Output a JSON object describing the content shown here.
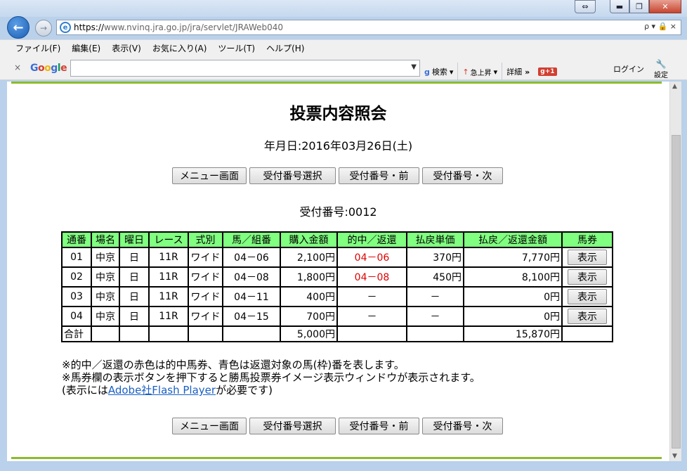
{
  "browser": {
    "window_buttons": {
      "extra": "⇔",
      "minimize": "▬",
      "maximize": "❐",
      "close": "✕"
    },
    "url_proto": "https://",
    "url_rest": "www.nvinq.jra.go.jp/jra/servlet/JRAWeb040",
    "url_tools": "ρ ▾ 🔒 ×",
    "menu": [
      "ファイル(F)",
      "編集(E)",
      "表示(V)",
      "お気に入り(A)",
      "ツール(T)",
      "ヘルプ(H)"
    ],
    "google_bar": {
      "close": "×",
      "logo": "Google",
      "search_value": "",
      "search_label": "検索",
      "rise_label": "急上昇",
      "detail_label": "詳細",
      "gplus": "g+1",
      "login": "ログイン",
      "settings": "設定"
    }
  },
  "page": {
    "title": "投票内容照会",
    "date_line": "年月日:2016年03月26日(土)",
    "buttons": [
      "メニュー画面",
      "受付番号選択",
      "受付番号・前",
      "受付番号・次"
    ],
    "receipt": "受付番号:0012",
    "table": {
      "headers": [
        "通番",
        "場名",
        "曜日",
        "レース",
        "式別",
        "馬／組番",
        "購入金額",
        "的中／返還",
        "払戻単価",
        "払戻／返還金額",
        "馬券"
      ],
      "rows": [
        {
          "no": "01",
          "venue": "中京",
          "day": "日",
          "race": "11R",
          "type": "ワイド",
          "combo": "04－06",
          "amount": "2,100円",
          "hit": "04－06",
          "unit": "370円",
          "payout": "7,770円",
          "btn": "表示"
        },
        {
          "no": "02",
          "venue": "中京",
          "day": "日",
          "race": "11R",
          "type": "ワイド",
          "combo": "04－08",
          "amount": "1,800円",
          "hit": "04－08",
          "unit": "450円",
          "payout": "8,100円",
          "btn": "表示"
        },
        {
          "no": "03",
          "venue": "中京",
          "day": "日",
          "race": "11R",
          "type": "ワイド",
          "combo": "04－11",
          "amount": "400円",
          "hit": "－",
          "unit": "－",
          "payout": "0円",
          "btn": "表示"
        },
        {
          "no": "04",
          "venue": "中京",
          "day": "日",
          "race": "11R",
          "type": "ワイド",
          "combo": "04－15",
          "amount": "700円",
          "hit": "－",
          "unit": "－",
          "payout": "0円",
          "btn": "表示"
        }
      ],
      "total_label": "合計",
      "total_amount": "5,000円",
      "total_payout": "15,870円"
    },
    "notes": {
      "line1": "※的中／返還の赤色は的中馬券、青色は返還対象の馬(枠)番を表します。",
      "line2": "※馬券欄の表示ボタンを押下すると勝馬投票券イメージ表示ウィンドウが表示されます。",
      "line3_pre": "(表示には",
      "line3_link": "Adobe社Flash Player",
      "line3_post": "が必要です)"
    },
    "hit_color": "#e00000",
    "header_color": "#80ff80",
    "rule_color": "#8cbb2a"
  }
}
